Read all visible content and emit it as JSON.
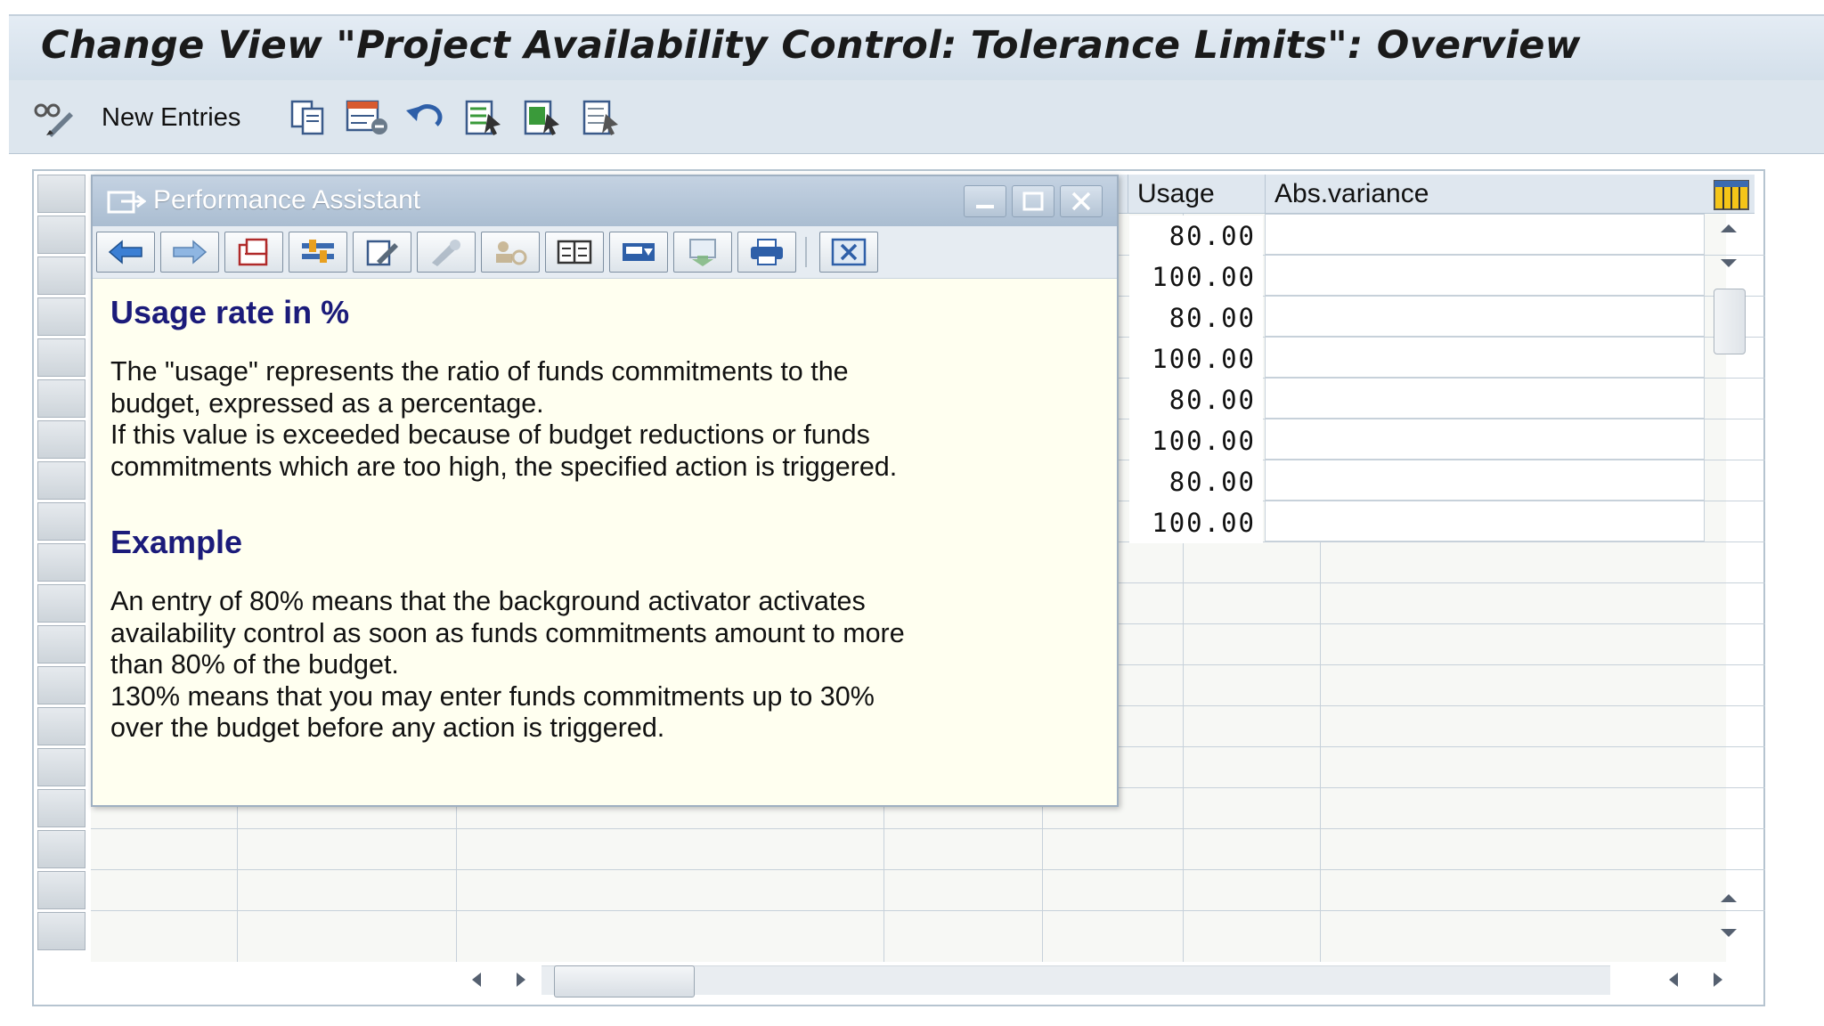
{
  "window": {
    "title": "Change View \"Project Availability Control: Tolerance Limits\": Overview"
  },
  "toolbar": {
    "new_entries_label": "New Entries",
    "icons": [
      "display-change-icon",
      "copy-icon",
      "delete-icon",
      "undo-icon",
      "select-all-icon",
      "select-block-icon",
      "deselect-all-icon"
    ]
  },
  "table": {
    "columns": [
      {
        "label": "Usage"
      },
      {
        "label": "Abs.variance"
      }
    ],
    "usage_values": [
      "80.00",
      "100.00",
      "80.00",
      "100.00",
      "80.00",
      "100.00",
      "80.00",
      "100.00"
    ]
  },
  "assistant": {
    "title": "Performance Assistant",
    "toolbar_icons": [
      "back-icon",
      "forward-icon",
      "technical-info-icon",
      "settings-icon",
      "edit-icon",
      "tool-icon",
      "users-icon",
      "book-icon",
      "document-icon",
      "export-icon",
      "print-icon",
      "close-icon"
    ],
    "heading1": "Usage rate in %",
    "para1": "The \"usage\" represents the ratio of funds commitments to the\nbudget, expressed as a percentage.\nIf this value is exceeded because of budget reductions or funds\ncommitments which are too high, the specified action is triggered.",
    "heading2": "Example",
    "para2": "An entry of 80% means that the background activator activates\navailability control as soon as funds commitments amount to more\nthan 80% of the budget.\n130% means that you may enter funds commitments up to 30%\nover the budget before any action is triggered."
  },
  "colors": {
    "title_bg": "#dbe5ef",
    "help_bg": "#fffff0",
    "heading_color": "#1b1b7a"
  }
}
